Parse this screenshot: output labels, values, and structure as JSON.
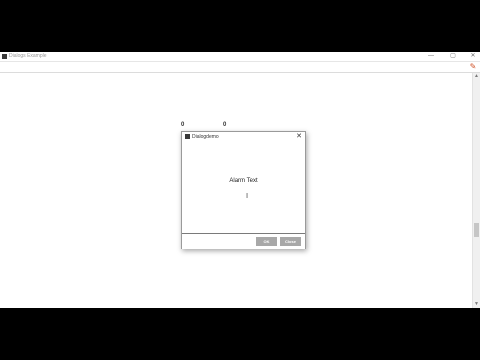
{
  "window": {
    "title": "Dialogs Example",
    "controls": {
      "minimize": "—",
      "maximize": "▢",
      "close": "✕"
    }
  },
  "toolbar": {
    "tool_icon": "paint-brush-icon"
  },
  "counters": [
    "0",
    "0"
  ],
  "dialog": {
    "title": "Dialogdemo",
    "close": "✕",
    "message": "Alarm Text",
    "cursor": "I",
    "ok_label": "OK",
    "close_label": "Close"
  },
  "scrollbar": {
    "up": "▲",
    "down": "▼"
  },
  "colors": {
    "background": "#ffffff",
    "letterbox": "#000000",
    "button": "#a8a8a8",
    "accent": "#d0542a"
  }
}
